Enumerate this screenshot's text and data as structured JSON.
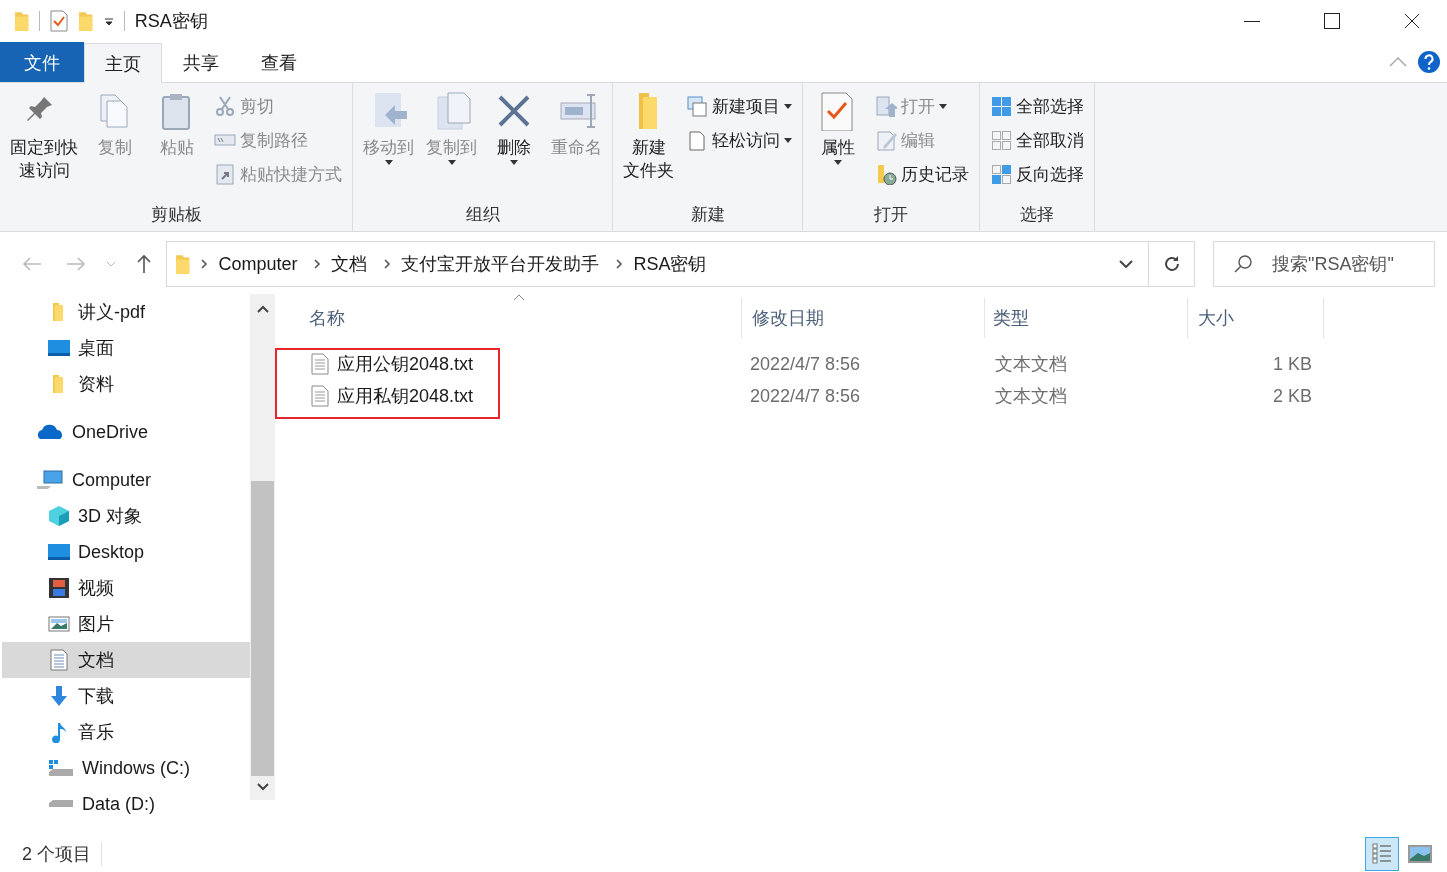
{
  "window": {
    "title": "RSA密钥"
  },
  "ribbon_tabs": [
    {
      "label": "文件",
      "kind": "file",
      "selected": false
    },
    {
      "label": "主页",
      "kind": "tab",
      "selected": true
    },
    {
      "label": "共享",
      "kind": "tab",
      "selected": false
    },
    {
      "label": "查看",
      "kind": "tab",
      "selected": false
    }
  ],
  "ribbon_groups": [
    {
      "label": "剪贴板",
      "commands": [
        {
          "label": [
            "固定到快",
            "速访问"
          ],
          "kind": "large",
          "disabled": false,
          "dropdown": false
        },
        {
          "label": [
            "复制"
          ],
          "kind": "large",
          "disabled": true,
          "dropdown": false
        },
        {
          "label": [
            "粘贴"
          ],
          "kind": "large",
          "disabled": true,
          "dropdown": false
        },
        {
          "label": [
            "剪切"
          ],
          "kind": "small",
          "disabled": true,
          "dropdown": false
        },
        {
          "label": [
            "复制路径"
          ],
          "kind": "small",
          "disabled": true,
          "dropdown": false
        },
        {
          "label": [
            "粘贴快捷方式"
          ],
          "kind": "small",
          "disabled": true,
          "dropdown": false
        }
      ]
    },
    {
      "label": "组织",
      "commands": [
        {
          "label": [
            "移动到"
          ],
          "kind": "large",
          "disabled": true,
          "dropdown": true
        },
        {
          "label": [
            "复制到"
          ],
          "kind": "large",
          "disabled": true,
          "dropdown": true
        },
        {
          "label": [
            "删除"
          ],
          "kind": "large",
          "disabled": false,
          "dropdown": true
        },
        {
          "label": [
            "重命名"
          ],
          "kind": "large",
          "disabled": true,
          "dropdown": false
        }
      ]
    },
    {
      "label": "新建",
      "commands": [
        {
          "label": [
            "新建",
            "文件夹"
          ],
          "kind": "large",
          "disabled": false,
          "dropdown": false
        },
        {
          "label": [
            "新建项目"
          ],
          "kind": "small",
          "disabled": false,
          "dropdown": true
        },
        {
          "label": [
            "轻松访问"
          ],
          "kind": "small",
          "disabled": false,
          "dropdown": true
        }
      ]
    },
    {
      "label": "打开",
      "commands": [
        {
          "label": [
            "属性"
          ],
          "kind": "large",
          "disabled": false,
          "dropdown": true
        },
        {
          "label": [
            "打开"
          ],
          "kind": "small",
          "disabled": true,
          "dropdown": true
        },
        {
          "label": [
            "编辑"
          ],
          "kind": "small",
          "disabled": true,
          "dropdown": false
        },
        {
          "label": [
            "历史记录"
          ],
          "kind": "small",
          "disabled": false,
          "dropdown": false
        }
      ]
    },
    {
      "label": "选择",
      "commands": [
        {
          "label": [
            "全部选择"
          ],
          "kind": "small",
          "disabled": false,
          "dropdown": false
        },
        {
          "label": [
            "全部取消"
          ],
          "kind": "small",
          "disabled": false,
          "dropdown": false
        },
        {
          "label": [
            "反向选择"
          ],
          "kind": "small",
          "disabled": false,
          "dropdown": false
        }
      ]
    }
  ],
  "address_bar": {
    "breadcrumbs": [
      "Computer",
      "文档",
      "支付宝开放平台开发助手",
      "RSA密钥"
    ]
  },
  "search": {
    "placeholder": "搜索\"RSA密钥\""
  },
  "navigation": {
    "items": [
      {
        "label": "讲义-pdf",
        "kind": "folder",
        "selected": false,
        "indented": true
      },
      {
        "label": "桌面",
        "kind": "desktop",
        "selected": false,
        "indented": true
      },
      {
        "label": "资料",
        "kind": "folder",
        "selected": false,
        "indented": true
      },
      {
        "label": "OneDrive",
        "kind": "cloud",
        "selected": false,
        "indented": false
      },
      {
        "label": "Computer",
        "kind": "computer",
        "selected": false,
        "indented": false,
        "children": [
          {
            "label": "3D 对象",
            "kind": "cube",
            "selected": false
          },
          {
            "label": "Desktop",
            "kind": "desktop",
            "selected": false
          },
          {
            "label": "视频",
            "kind": "video",
            "selected": false
          },
          {
            "label": "图片",
            "kind": "pictures",
            "selected": false
          },
          {
            "label": "文档",
            "kind": "documents",
            "selected": true
          },
          {
            "label": "下载",
            "kind": "download",
            "selected": false
          },
          {
            "label": "音乐",
            "kind": "music",
            "selected": false
          },
          {
            "label": "Windows (C:)",
            "kind": "system-drive",
            "selected": false
          },
          {
            "label": "Data (D:)",
            "kind": "drive",
            "selected": false
          }
        ]
      }
    ]
  },
  "file_list": {
    "columns": [
      "名称",
      "修改日期",
      "类型",
      "大小"
    ],
    "rows": [
      {
        "name": "应用公钥2048.txt",
        "modified": "2022/4/7 8:56",
        "type": "文本文档",
        "size": "1 KB",
        "selected": false
      },
      {
        "name": "应用私钥2048.txt",
        "modified": "2022/4/7 8:56",
        "type": "文本文档",
        "size": "2 KB",
        "selected": false
      }
    ],
    "highlighted": true
  },
  "status_bar": {
    "item_count": "2 个项目",
    "view_modes": [
      {
        "selected": true
      },
      {
        "selected": false
      }
    ]
  }
}
